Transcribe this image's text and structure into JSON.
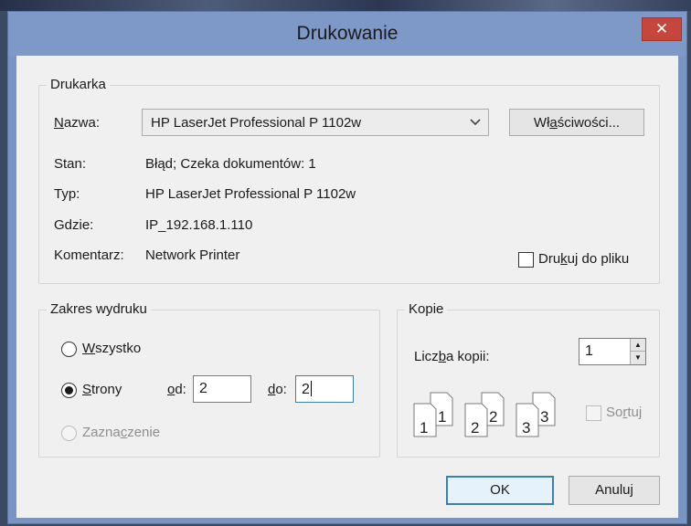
{
  "window": {
    "title": "Drukowanie",
    "close_glyph": "✕"
  },
  "printer": {
    "legend": "Drukarka",
    "name_label": "Nazwa:",
    "name_value": "HP LaserJet Professional P 1102w",
    "properties_button": "Właściwości...",
    "status_label": "Stan:",
    "status_value": "Błąd; Czeka dokumentów: 1",
    "type_label": "Typ:",
    "type_value": "HP LaserJet Professional P 1102w",
    "where_label": "Gdzie:",
    "where_value": "IP_192.168.1.110",
    "comment_label": "Komentarz:",
    "comment_value": "Network Printer",
    "print_to_file_label": "Drukuj do pliku",
    "print_to_file_checked": false
  },
  "range": {
    "legend": "Zakres wydruku",
    "all_label": "Wszystko",
    "pages_label": "Strony",
    "from_label": "od:",
    "from_value": "2",
    "to_label": "do:",
    "to_value": "2",
    "selection_label": "Zaznaczenie",
    "selected_option": "pages"
  },
  "copies": {
    "legend": "Kopie",
    "count_label": "Liczba kopii:",
    "count_value": "1",
    "collate_label": "Sortuj",
    "collate_checked": false,
    "collate_icon_numbers": [
      "1",
      "1",
      "2",
      "2",
      "3",
      "3"
    ]
  },
  "buttons": {
    "ok": "OK",
    "cancel": "Anuluj"
  },
  "colors": {
    "titlebar": "#7e98c8",
    "close": "#c7463c",
    "focus": "#3c7fb1"
  }
}
